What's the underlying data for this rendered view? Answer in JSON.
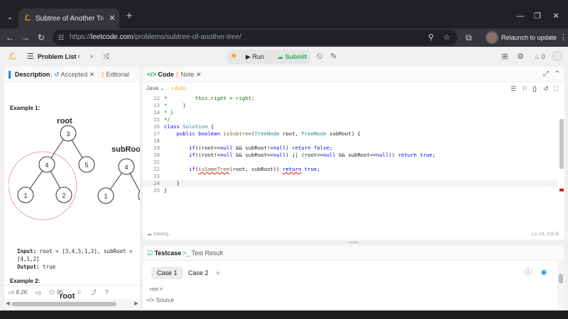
{
  "browser": {
    "tab_title": "Subtree of Another Tree - LeetC",
    "url_prefix": "https://",
    "url_host": "leetcode.com",
    "url_path": "/problems/subtree-of-another-tree/",
    "relaunch_label": "Relaunch to update"
  },
  "lc_header": {
    "problem_list_label": "Problem List",
    "run_label": "Run",
    "submit_label": "Submit",
    "fire_count": "0"
  },
  "left_panel": {
    "tabs": {
      "description": "Description",
      "accepted": "Accepted",
      "editorial": "Editorial"
    },
    "example1_heading": "Example 1:",
    "tree_label_root": "root",
    "tree_label_subroot": "subRoot",
    "root_nodes": [
      "3",
      "4",
      "5",
      "1",
      "2"
    ],
    "subroot_nodes": [
      "4",
      "1"
    ],
    "input_label": "Input:",
    "input_text": " root = [3,4,5,1,2], subRoot =",
    "input_cont": "[4,1,2]",
    "output_label": "Output:",
    "output_text": " true",
    "example2_heading": "Example 2:",
    "example2_root": "root",
    "likes": "8.2K",
    "comments": "85"
  },
  "code_panel": {
    "tabs": {
      "code": "Code",
      "note": "Note"
    },
    "language": "Java",
    "auto_label": "Auto",
    "line_numbers": [
      "12",
      "13",
      "14",
      "15",
      "16",
      "17",
      "18",
      "19",
      "20",
      "21",
      "22",
      "23",
      "24",
      "25"
    ],
    "saving_text": "Saving...",
    "cursor_pos": "Ln 24, Col 6"
  },
  "testcase_panel": {
    "tabs": {
      "testcase": "Testcase",
      "result": "Test Result"
    },
    "cases": [
      "Case 1",
      "Case 2"
    ],
    "root_label": "root =",
    "source_label": "Source"
  }
}
